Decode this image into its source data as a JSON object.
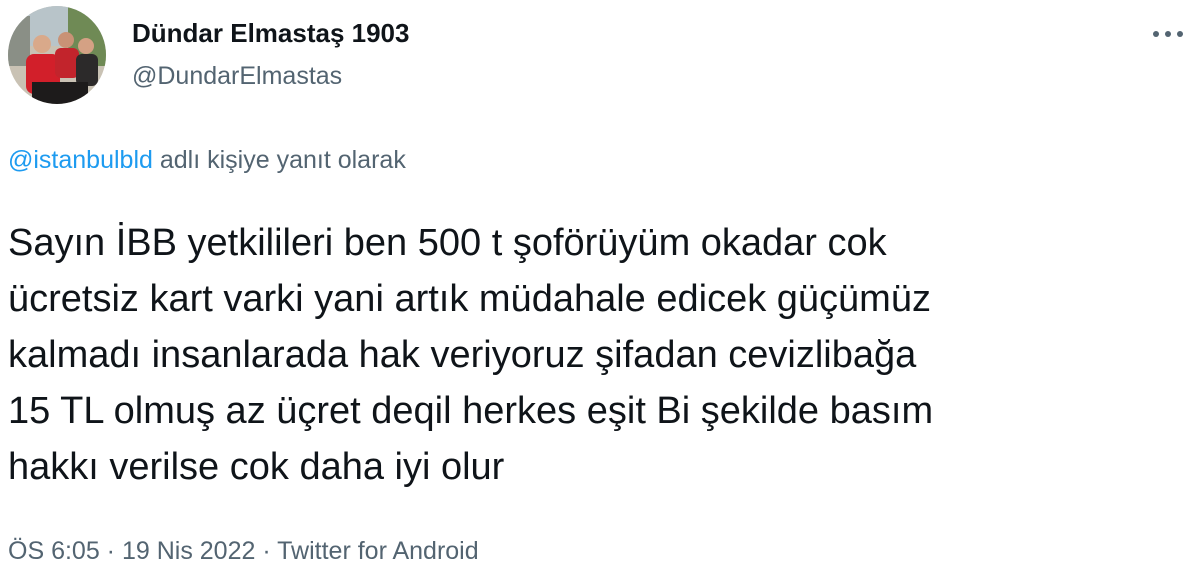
{
  "user": {
    "display_name": "Dündar Elmastaş 1903",
    "handle": "@DundarElmastas",
    "avatar_icon": "profile-photo"
  },
  "more_icon": "more-horizontal-icon",
  "reply": {
    "mention": "@istanbulbld",
    "suffix": " adlı kişiye yanıt olarak"
  },
  "tweet": {
    "lines": [
      "Sayın İBB yetkilileri ben 500 t şoförüyüm okadar cok",
      "ücretsiz kart varki yani artık müdahale edicek güçümüz",
      "kalmadı insanlarada hak veriyoruz şifadan cevizlibağa",
      "15 TL olmuş az üçret deqil herkes eşit Bi şekilde basım",
      "hakkı verilse cok daha iyi olur"
    ]
  },
  "meta": {
    "time": "ÖS 6:05",
    "sep1": " · ",
    "date": "19 Nis 2022",
    "sep2": " · ",
    "source": "Twitter for Android"
  },
  "colors": {
    "text": "#0f1419",
    "secondary": "#536471",
    "link": "#1d9bf0"
  }
}
